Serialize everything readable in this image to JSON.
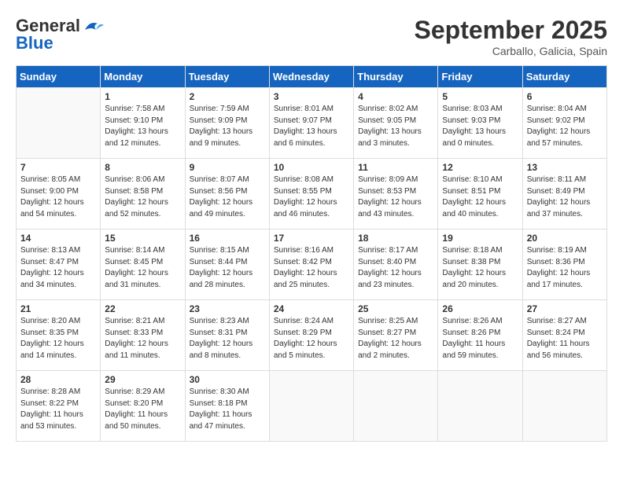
{
  "header": {
    "logo_general": "General",
    "logo_blue": "Blue",
    "month": "September 2025",
    "location": "Carballo, Galicia, Spain"
  },
  "days_of_week": [
    "Sunday",
    "Monday",
    "Tuesday",
    "Wednesday",
    "Thursday",
    "Friday",
    "Saturday"
  ],
  "weeks": [
    [
      {
        "day": "",
        "sunrise": "",
        "sunset": "",
        "daylight": "",
        "empty": true
      },
      {
        "day": "1",
        "sunrise": "7:58 AM",
        "sunset": "9:10 PM",
        "daylight": "13 hours and 12 minutes.",
        "empty": false
      },
      {
        "day": "2",
        "sunrise": "7:59 AM",
        "sunset": "9:09 PM",
        "daylight": "13 hours and 9 minutes.",
        "empty": false
      },
      {
        "day": "3",
        "sunrise": "8:01 AM",
        "sunset": "9:07 PM",
        "daylight": "13 hours and 6 minutes.",
        "empty": false
      },
      {
        "day": "4",
        "sunrise": "8:02 AM",
        "sunset": "9:05 PM",
        "daylight": "13 hours and 3 minutes.",
        "empty": false
      },
      {
        "day": "5",
        "sunrise": "8:03 AM",
        "sunset": "9:03 PM",
        "daylight": "13 hours and 0 minutes.",
        "empty": false
      },
      {
        "day": "6",
        "sunrise": "8:04 AM",
        "sunset": "9:02 PM",
        "daylight": "12 hours and 57 minutes.",
        "empty": false
      }
    ],
    [
      {
        "day": "7",
        "sunrise": "8:05 AM",
        "sunset": "9:00 PM",
        "daylight": "12 hours and 54 minutes.",
        "empty": false
      },
      {
        "day": "8",
        "sunrise": "8:06 AM",
        "sunset": "8:58 PM",
        "daylight": "12 hours and 52 minutes.",
        "empty": false
      },
      {
        "day": "9",
        "sunrise": "8:07 AM",
        "sunset": "8:56 PM",
        "daylight": "12 hours and 49 minutes.",
        "empty": false
      },
      {
        "day": "10",
        "sunrise": "8:08 AM",
        "sunset": "8:55 PM",
        "daylight": "12 hours and 46 minutes.",
        "empty": false
      },
      {
        "day": "11",
        "sunrise": "8:09 AM",
        "sunset": "8:53 PM",
        "daylight": "12 hours and 43 minutes.",
        "empty": false
      },
      {
        "day": "12",
        "sunrise": "8:10 AM",
        "sunset": "8:51 PM",
        "daylight": "12 hours and 40 minutes.",
        "empty": false
      },
      {
        "day": "13",
        "sunrise": "8:11 AM",
        "sunset": "8:49 PM",
        "daylight": "12 hours and 37 minutes.",
        "empty": false
      }
    ],
    [
      {
        "day": "14",
        "sunrise": "8:13 AM",
        "sunset": "8:47 PM",
        "daylight": "12 hours and 34 minutes.",
        "empty": false
      },
      {
        "day": "15",
        "sunrise": "8:14 AM",
        "sunset": "8:45 PM",
        "daylight": "12 hours and 31 minutes.",
        "empty": false
      },
      {
        "day": "16",
        "sunrise": "8:15 AM",
        "sunset": "8:44 PM",
        "daylight": "12 hours and 28 minutes.",
        "empty": false
      },
      {
        "day": "17",
        "sunrise": "8:16 AM",
        "sunset": "8:42 PM",
        "daylight": "12 hours and 25 minutes.",
        "empty": false
      },
      {
        "day": "18",
        "sunrise": "8:17 AM",
        "sunset": "8:40 PM",
        "daylight": "12 hours and 23 minutes.",
        "empty": false
      },
      {
        "day": "19",
        "sunrise": "8:18 AM",
        "sunset": "8:38 PM",
        "daylight": "12 hours and 20 minutes.",
        "empty": false
      },
      {
        "day": "20",
        "sunrise": "8:19 AM",
        "sunset": "8:36 PM",
        "daylight": "12 hours and 17 minutes.",
        "empty": false
      }
    ],
    [
      {
        "day": "21",
        "sunrise": "8:20 AM",
        "sunset": "8:35 PM",
        "daylight": "12 hours and 14 minutes.",
        "empty": false
      },
      {
        "day": "22",
        "sunrise": "8:21 AM",
        "sunset": "8:33 PM",
        "daylight": "12 hours and 11 minutes.",
        "empty": false
      },
      {
        "day": "23",
        "sunrise": "8:23 AM",
        "sunset": "8:31 PM",
        "daylight": "12 hours and 8 minutes.",
        "empty": false
      },
      {
        "day": "24",
        "sunrise": "8:24 AM",
        "sunset": "8:29 PM",
        "daylight": "12 hours and 5 minutes.",
        "empty": false
      },
      {
        "day": "25",
        "sunrise": "8:25 AM",
        "sunset": "8:27 PM",
        "daylight": "12 hours and 2 minutes.",
        "empty": false
      },
      {
        "day": "26",
        "sunrise": "8:26 AM",
        "sunset": "8:26 PM",
        "daylight": "11 hours and 59 minutes.",
        "empty": false
      },
      {
        "day": "27",
        "sunrise": "8:27 AM",
        "sunset": "8:24 PM",
        "daylight": "11 hours and 56 minutes.",
        "empty": false
      }
    ],
    [
      {
        "day": "28",
        "sunrise": "8:28 AM",
        "sunset": "8:22 PM",
        "daylight": "11 hours and 53 minutes.",
        "empty": false
      },
      {
        "day": "29",
        "sunrise": "8:29 AM",
        "sunset": "8:20 PM",
        "daylight": "11 hours and 50 minutes.",
        "empty": false
      },
      {
        "day": "30",
        "sunrise": "8:30 AM",
        "sunset": "8:18 PM",
        "daylight": "11 hours and 47 minutes.",
        "empty": false
      },
      {
        "day": "",
        "sunrise": "",
        "sunset": "",
        "daylight": "",
        "empty": true
      },
      {
        "day": "",
        "sunrise": "",
        "sunset": "",
        "daylight": "",
        "empty": true
      },
      {
        "day": "",
        "sunrise": "",
        "sunset": "",
        "daylight": "",
        "empty": true
      },
      {
        "day": "",
        "sunrise": "",
        "sunset": "",
        "daylight": "",
        "empty": true
      }
    ]
  ],
  "labels": {
    "sunrise_prefix": "Sunrise: ",
    "sunset_prefix": "Sunset: ",
    "daylight_prefix": "Daylight: "
  }
}
